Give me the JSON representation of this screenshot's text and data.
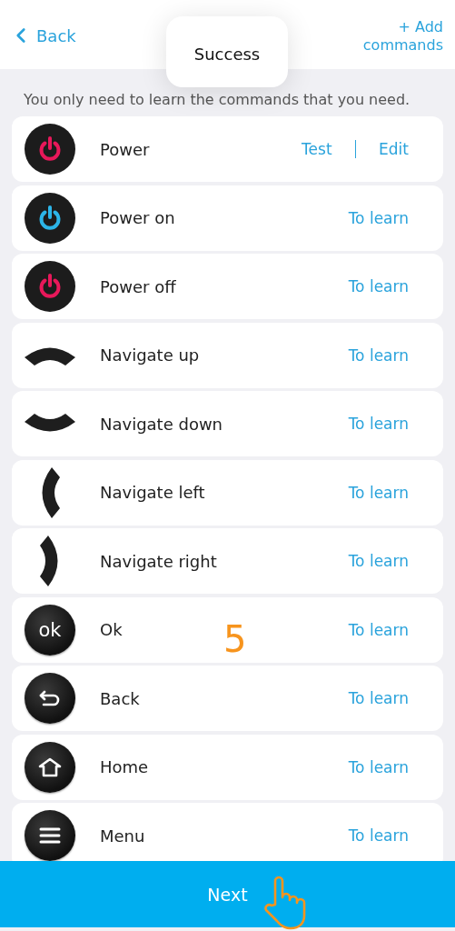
{
  "header": {
    "back_label": "Back",
    "add_label": "+ Add commands"
  },
  "toast": "Success",
  "hint": "You only need to learn the commands that you need.",
  "commands": [
    {
      "label": "Power",
      "kind": "power",
      "color": "#e8185a",
      "actions": [
        "Test",
        "Edit"
      ]
    },
    {
      "label": "Power on",
      "kind": "power",
      "color": "#2cb5e8",
      "actions": [
        "To learn"
      ]
    },
    {
      "label": "Power off",
      "kind": "power",
      "color": "#e8185a",
      "actions": [
        "To learn"
      ]
    },
    {
      "label": "Navigate up",
      "kind": "nav-up",
      "actions": [
        "To learn"
      ]
    },
    {
      "label": "Navigate down",
      "kind": "nav-down",
      "actions": [
        "To learn"
      ]
    },
    {
      "label": "Navigate left",
      "kind": "nav-left",
      "actions": [
        "To learn"
      ]
    },
    {
      "label": "Navigate right",
      "kind": "nav-right",
      "actions": [
        "To learn"
      ]
    },
    {
      "label": "Ok",
      "kind": "ok",
      "icon_text": "ok",
      "actions": [
        "To learn"
      ]
    },
    {
      "label": "Back",
      "kind": "back",
      "actions": [
        "To learn"
      ]
    },
    {
      "label": "Home",
      "kind": "home",
      "actions": [
        "To learn"
      ]
    },
    {
      "label": "Menu",
      "kind": "menu",
      "actions": [
        "To learn"
      ]
    }
  ],
  "step_marker": "5",
  "next_button": "Next"
}
